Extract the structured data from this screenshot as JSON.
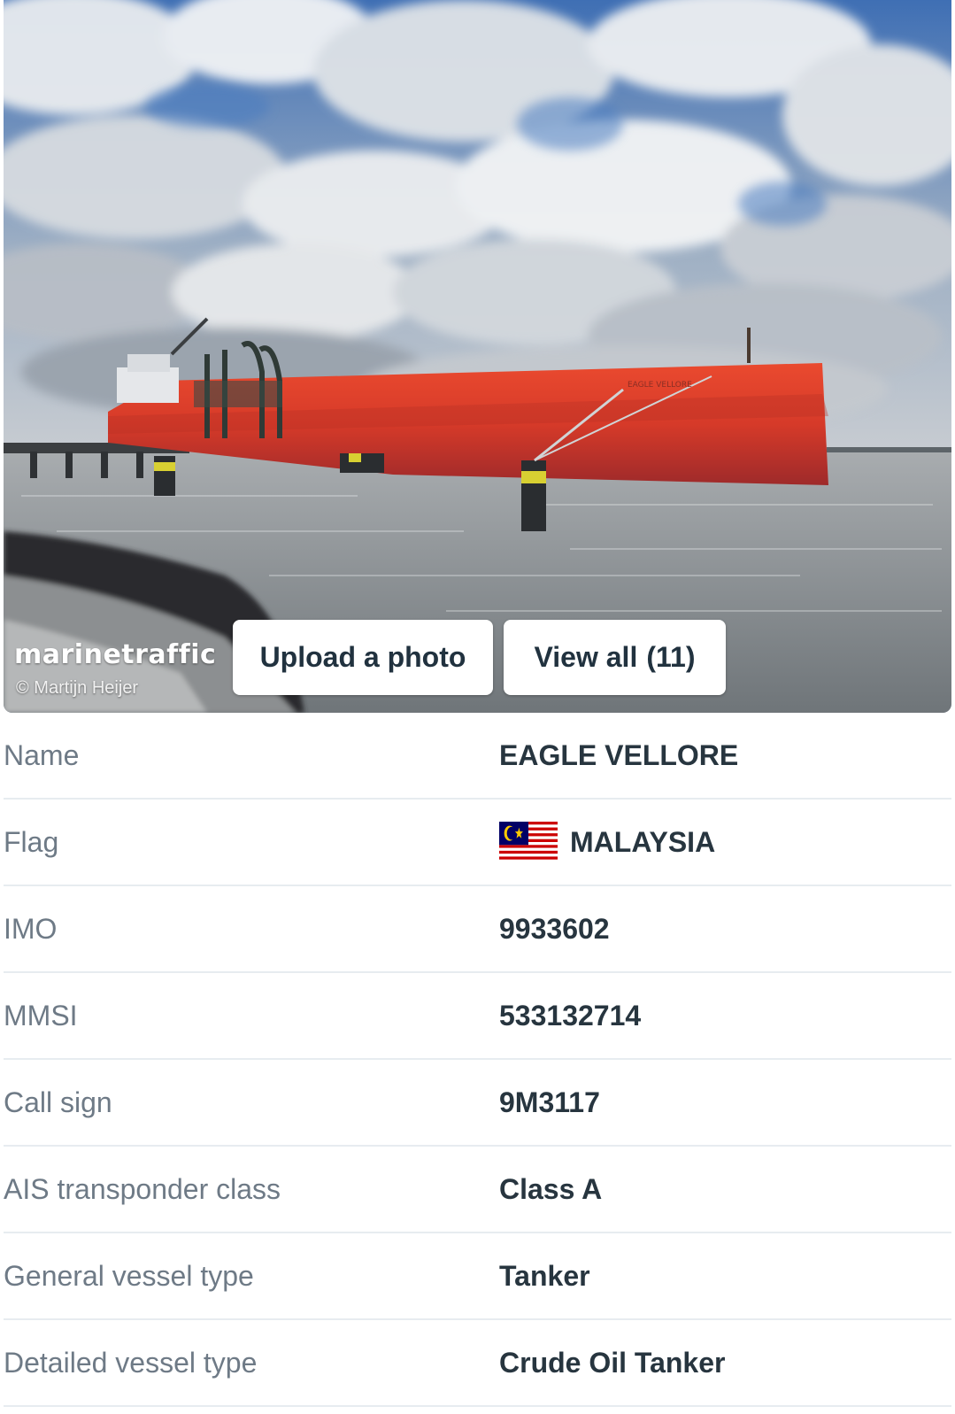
{
  "photo": {
    "watermark": "marinetraffic",
    "credit": "© Martijn Heijer",
    "upload_label": "Upload a photo",
    "view_all_label": "View all",
    "view_all_count": "(11)",
    "ship_hull_name": "EAGLE VELLORE"
  },
  "details": {
    "rows": [
      {
        "label": "Name",
        "value": "EAGLE VELLORE"
      },
      {
        "label": "Flag",
        "value": "MALAYSIA",
        "icon": "malaysia-flag-icon"
      },
      {
        "label": "IMO",
        "value": "9933602"
      },
      {
        "label": "MMSI",
        "value": "533132714"
      },
      {
        "label": "Call sign",
        "value": "9M3117"
      },
      {
        "label": "AIS transponder class",
        "value": "Class A"
      },
      {
        "label": "General vessel type",
        "value": "Tanker"
      },
      {
        "label": "Detailed vessel type",
        "value": "Crude Oil Tanker"
      }
    ]
  },
  "colors": {
    "label_text": "#6e7a86",
    "value_text": "#27353f",
    "divider": "#e7ecf0",
    "hull_red": "#e2412c",
    "sky_blue": "#4f7fbd"
  }
}
